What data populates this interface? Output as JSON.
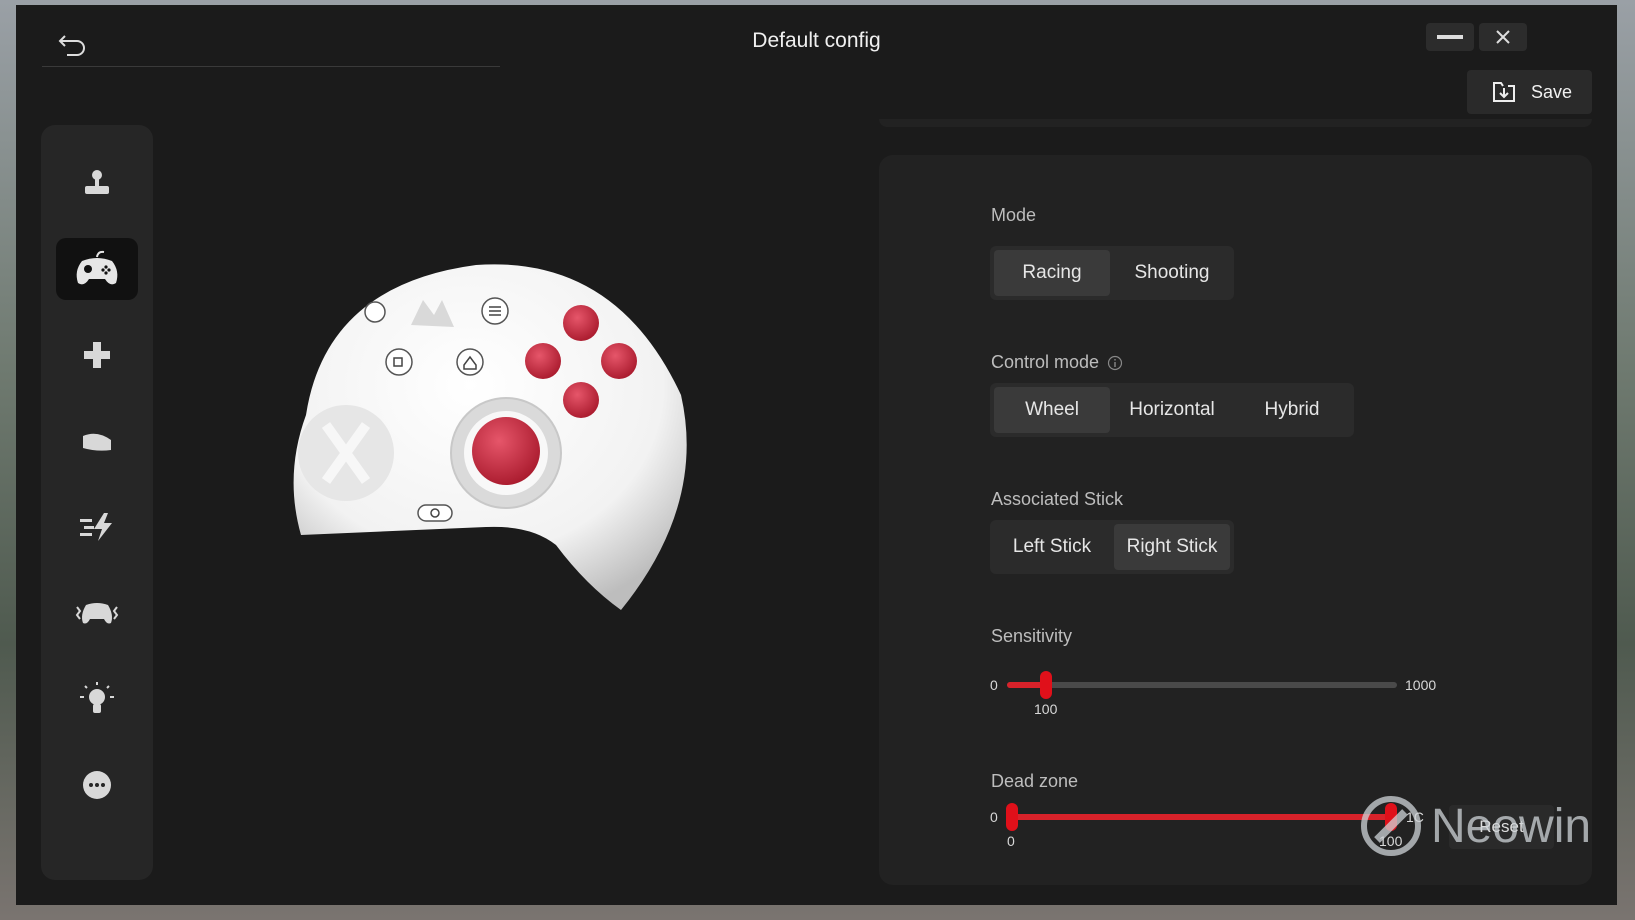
{
  "window": {
    "title": "Default config",
    "save_label": "Save"
  },
  "sidebar": {
    "items": [
      {
        "icon": "joystick-icon"
      },
      {
        "icon": "gamepad-icon",
        "active": true
      },
      {
        "icon": "dpad-icon"
      },
      {
        "icon": "trigger-icon"
      },
      {
        "icon": "turbo-icon"
      },
      {
        "icon": "vibration-icon"
      },
      {
        "icon": "light-icon"
      },
      {
        "icon": "more-icon"
      }
    ]
  },
  "settings": {
    "mode": {
      "label": "Mode",
      "options": [
        "Racing",
        "Shooting"
      ],
      "selected": "Racing"
    },
    "control_mode": {
      "label": "Control mode",
      "options": [
        "Wheel",
        "Horizontal",
        "Hybrid"
      ],
      "selected": "Wheel"
    },
    "associated_stick": {
      "label": "Associated Stick",
      "options": [
        "Left Stick",
        "Right Stick"
      ],
      "selected": "Right Stick"
    },
    "sensitivity": {
      "label": "Sensitivity",
      "min": "0",
      "max": "1000",
      "value": "100",
      "fraction": 0.1
    },
    "dead_zone": {
      "label": "Dead zone",
      "min": "0",
      "max": "100",
      "low": "0",
      "high": "100",
      "max_visible": "1C"
    },
    "reset_label": "Reset"
  },
  "watermark": "Neowin",
  "colors": {
    "accent": "#e0101a",
    "background": "#1b1b1b",
    "panel": "#222222"
  }
}
